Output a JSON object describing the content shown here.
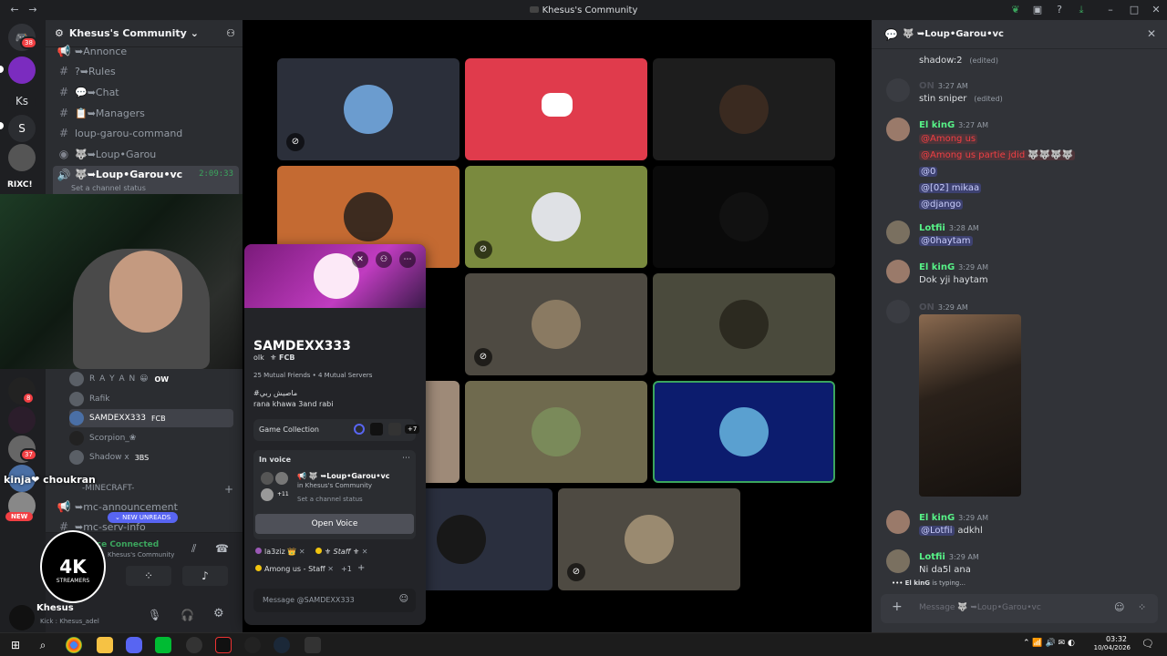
{
  "window": {
    "title": "Khesus's Community"
  },
  "rail": {
    "badge1": "38",
    "ks": "Ks",
    "rixc": "RIXC!",
    "badge2": "8",
    "badge3": "37",
    "new_label": "NEW"
  },
  "server": {
    "name": "Khesus's Community",
    "channels": [
      {
        "icon": "megaphone-icon",
        "name": "➥Annonce"
      },
      {
        "icon": "hash-icon",
        "name": "?➥Rules"
      },
      {
        "icon": "hash-icon",
        "name": "💬➥Chat"
      },
      {
        "icon": "hash-icon",
        "name": "📋➥Managers"
      },
      {
        "icon": "hash-icon",
        "name": "loup-garou-command"
      },
      {
        "icon": "voice-icon",
        "name": "🐺➥Loup•Garou"
      },
      {
        "icon": "voice-icon",
        "name": "🐺➥Loup•Garou•vc"
      }
    ],
    "active_timer": "2:09:33",
    "channel_status_placeholder": "Set a channel status",
    "members": [
      {
        "name": "R A Y A N 😀",
        "tag": "OW"
      },
      {
        "name": "Rafik",
        "tag": ""
      },
      {
        "name": "SAMDEXX333",
        "tag": "FCB"
      },
      {
        "name": "Scorpion_❀",
        "tag": ""
      },
      {
        "name": "Shadow x",
        "tag": "3BS"
      }
    ],
    "category": "-MINECRAFT-",
    "mc_channels": [
      "➥mc-announcement",
      "➥mc-serv-info"
    ],
    "new_unreads": "NEW UNREADS",
    "voice_connected": "Voice Connected",
    "voice_server": "Khesus's Community",
    "user_name": "Khesus",
    "user_status": "Kick : Khesus_adel",
    "overlay_text": "kinja❤ choukran",
    "logo_text": "4K",
    "logo_sub": "STREAMERS"
  },
  "popout": {
    "username": "SAMDEXX333",
    "handle": "olk",
    "tag": "FCB",
    "mutual": "25 Mutual Friends • 4 Mutual Servers",
    "bio_line1": "#ماصيش ربي",
    "bio_line2": "rana khawa 3and rabi",
    "game_collection": "Game Collection",
    "game_more": "+7",
    "in_voice": "In voice",
    "voice_channel": "📢 🐺 ➥Loup•Garou•vc",
    "voice_server": "in Khesus's Community",
    "voice_count": "+11",
    "voice_status": "Set a channel status",
    "open_voice": "Open Voice",
    "roles": [
      {
        "name": "la3ziz 👑",
        "color": "#9b59b6"
      },
      {
        "name": "⚜ Staff ⚜",
        "color": "#f1c40f"
      },
      {
        "name": "Among us - Staff",
        "color": "#f1c40f"
      }
    ],
    "roles_more": "+1",
    "message_placeholder": "Message @SAMDEXX333"
  },
  "chat": {
    "channel": "🐺 ➥Loup•Garou•vc",
    "messages": [
      {
        "user": "",
        "time": "",
        "text": "shadow:2",
        "edited": "(edited)"
      },
      {
        "user": "ON",
        "time": "3:27 AM",
        "text": "stin sniper",
        "edited": "(edited)"
      },
      {
        "user": "El kinG",
        "time": "3:27 AM",
        "lines": [
          "@Among us",
          "@Among us partie jdid 🐺🐺🐺🐺",
          "@0",
          "@[02] mikaa",
          "@django"
        ]
      },
      {
        "user": "Lotfii",
        "time": "3:28 AM",
        "text": "@0haytam"
      },
      {
        "user": "El kinG",
        "time": "3:29 AM",
        "text": "Dok yji haytam"
      },
      {
        "user": "ON",
        "time": "3:29 AM",
        "text": ""
      },
      {
        "user": "El kinG",
        "time": "3:29 AM",
        "mention": "@Lotfii",
        "text": "adkhl"
      },
      {
        "user": "Lotfii",
        "time": "3:29 AM",
        "text": "Ni da5l ana"
      }
    ],
    "typing_user": "El kinG",
    "typing_suffix": "is typing...",
    "input_placeholder": "Message 🐺 ➥Loup•Garou•vc",
    "colors": {
      "elking": "#57f287",
      "lotfii": "#57f287",
      "on": "#5a5f66"
    }
  },
  "taskbar": {
    "time": "03:32",
    "date": "10/04/2026"
  }
}
